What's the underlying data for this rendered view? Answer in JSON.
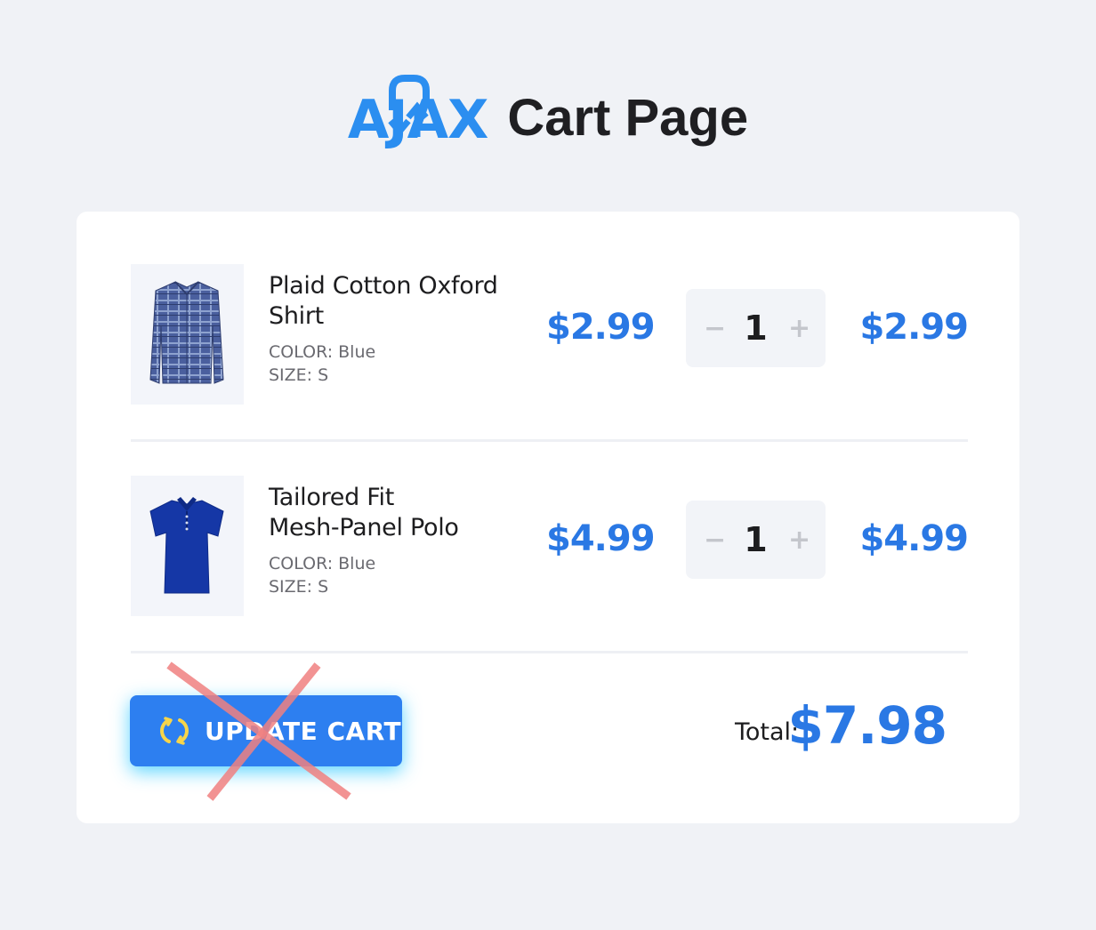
{
  "header": {
    "logo_text": "AJAX",
    "title": "Cart Page"
  },
  "cart": {
    "items": [
      {
        "name_line1": "Plaid Cotton Oxford",
        "name_line2": "Shirt",
        "color": "COLOR: Blue",
        "size": "SIZE: S",
        "price": "$2.99",
        "quantity": "1",
        "subtotal": "$2.99",
        "image_icon": "plaid-shirt-icon"
      },
      {
        "name_line1": "Tailored Fit",
        "name_line2": "Mesh-Panel Polo",
        "color": "COLOR: Blue",
        "size": "SIZE: S",
        "price": "$4.99",
        "quantity": "1",
        "subtotal": "$4.99",
        "image_icon": "polo-shirt-icon"
      }
    ],
    "qty_minus": "−",
    "qty_plus": "+",
    "update_button": "UPDATE CART",
    "total_label": "Total:",
    "total_value": "$7.98"
  },
  "colors": {
    "accent": "#2a78e4",
    "button": "#2d7ff0",
    "refresh_icon": "#f7d54a",
    "cross": "#f08080"
  }
}
